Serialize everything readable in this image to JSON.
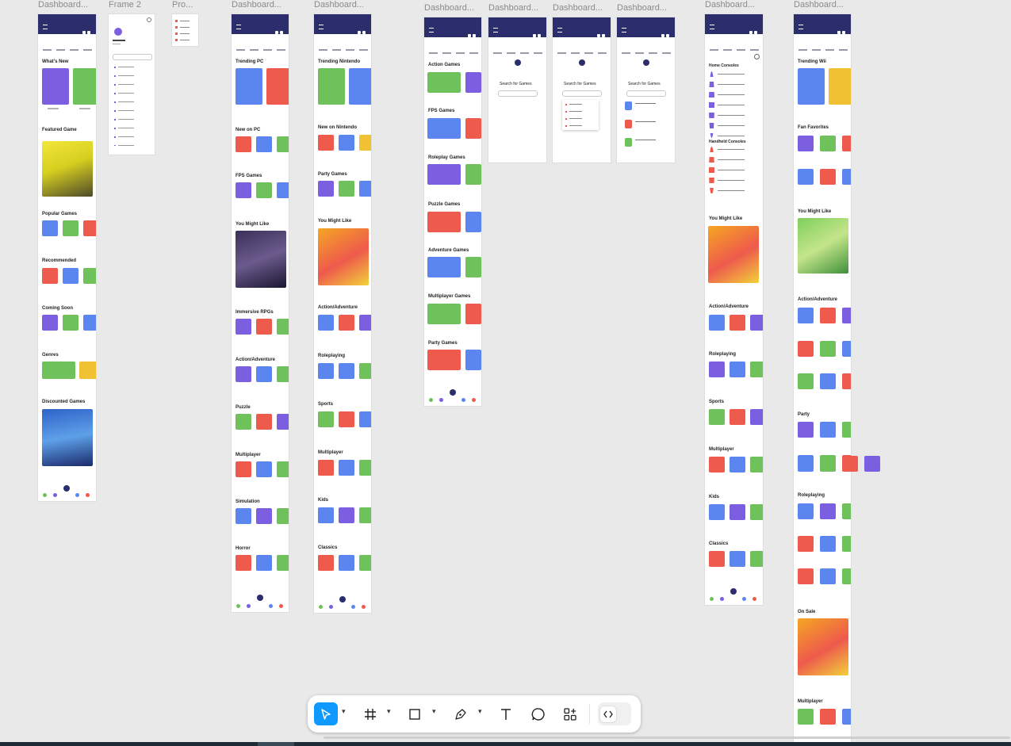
{
  "canvas": {
    "frame_labels": [
      "Dashboard...",
      "Frame 2",
      "Pro...",
      "Dashboard...",
      "Dashboard...",
      "Dashboard...",
      "Dashboard...",
      "Dashboard...",
      "Dashboard...",
      "Dashboard...",
      "Dashboard..."
    ]
  },
  "frame1": {
    "sections": [
      "What's New",
      "Featured Game",
      "Popular Games",
      "Recommended",
      "Coming Soon",
      "Genres",
      "Discounted Games"
    ]
  },
  "frame4": {
    "sections": [
      "Trending PC",
      "New on PC",
      "FPS Games",
      "You Might Like",
      "Immersive RPGs",
      "Action/Adventure",
      "Puzzle",
      "Multiplayer",
      "Simulation",
      "Horror"
    ]
  },
  "frame5": {
    "sections": [
      "Trending Nintendo",
      "New on Nintendo",
      "Party Games",
      "You Might Like",
      "Action/Adventure",
      "Roleplaying",
      "Sports",
      "Multiplayer",
      "Kids",
      "Classics"
    ]
  },
  "frame6": {
    "sections": [
      "Action Games",
      "FPS Games",
      "Roleplay Games",
      "Puzzle Games",
      "Adventure Games",
      "Multiplayer Games",
      "Party Games"
    ]
  },
  "search": {
    "title": "Search for Games"
  },
  "frame10": {
    "sections": [
      "Home Consoles",
      "Handheld Consoles",
      "You Might Like",
      "Action/Adventure",
      "Roleplaying",
      "Sports",
      "Multiplayer",
      "Kids",
      "Classics"
    ]
  },
  "frame11": {
    "sections": [
      "Trending Wii",
      "Fan Favorites",
      "You Might Like",
      "Action/Adventure",
      "Party",
      "Roleplaying",
      "On Sale",
      "Multiplayer"
    ]
  },
  "toolbar": {
    "tools": [
      "move-tool",
      "frame-tool",
      "shape-tool",
      "pen-tool",
      "text-tool",
      "comment-tool",
      "actions-tool",
      "dev-mode-toggle"
    ]
  },
  "colors": {
    "canvas": "#e9e9e9",
    "app_bar": "#2b2d6c",
    "selected_tool": "#0d99ff"
  }
}
